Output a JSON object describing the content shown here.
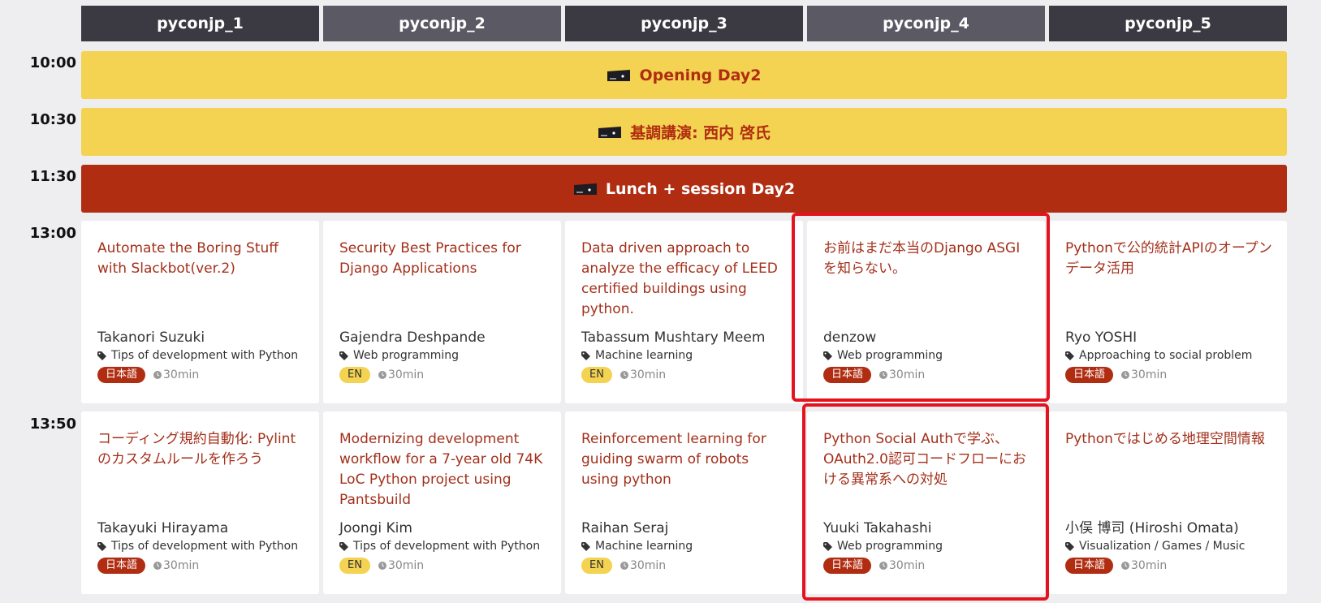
{
  "rooms": [
    "pyconjp_1",
    "pyconjp_2",
    "pyconjp_3",
    "pyconjp_4",
    "pyconjp_5"
  ],
  "times": [
    "10:00",
    "10:30",
    "11:30",
    "13:00",
    "13:50"
  ],
  "plenaries": [
    {
      "title": "Opening Day2",
      "style": "yellow",
      "icon": "ticket-icon"
    },
    {
      "title": "基調講演: 西内 啓氏",
      "style": "yellow",
      "icon": "ticket-icon"
    },
    {
      "title": "Lunch + session Day2",
      "style": "red",
      "icon": "ticket-icon"
    }
  ],
  "rows": [
    {
      "sessions": [
        {
          "title": "Automate the Boring Stuff with Slackbot(ver.2)",
          "speaker": "Takanori Suzuki",
          "category": "Tips of development with Python",
          "language": "日本語",
          "lang_code": "ja",
          "duration": "30min"
        },
        {
          "title": "Security Best Practices for Django Applications",
          "speaker": "Gajendra Deshpande",
          "category": "Web programming",
          "language": "EN",
          "lang_code": "en",
          "duration": "30min"
        },
        {
          "title": "Data driven approach to analyze the efficacy of LEED certified buildings using python.",
          "speaker": "Tabassum Mushtary Meem",
          "category": "Machine learning",
          "language": "EN",
          "lang_code": "en",
          "duration": "30min"
        },
        {
          "title": "お前はまだ本当のDjango ASGIを知らない。",
          "speaker": "denzow",
          "category": "Web programming",
          "language": "日本語",
          "lang_code": "ja",
          "duration": "30min"
        },
        {
          "title": "Pythonで公的統計APIのオープンデータ活用",
          "speaker": "Ryo YOSHI",
          "category": "Approaching to social problem",
          "language": "日本語",
          "lang_code": "ja",
          "duration": "30min"
        }
      ]
    },
    {
      "sessions": [
        {
          "title": "コーディング規約自動化: Pylintのカスタムルールを作ろう",
          "speaker": "Takayuki Hirayama",
          "category": "Tips of development with Python",
          "language": "日本語",
          "lang_code": "ja",
          "duration": "30min"
        },
        {
          "title": "Modernizing development workflow for a 7-year old 74K LoC Python project using Pantsbuild",
          "speaker": "Joongi Kim",
          "category": "Tips of development with Python",
          "language": "EN",
          "lang_code": "en",
          "duration": "30min"
        },
        {
          "title": "Reinforcement learning for guiding swarm of robots using python",
          "speaker": "Raihan Seraj",
          "category": "Machine learning",
          "language": "EN",
          "lang_code": "en",
          "duration": "30min"
        },
        {
          "title": "Python Social Authで学ぶ、OAuth2.0認可コードフローにおける異常系への対処",
          "speaker": "Yuuki Takahashi",
          "category": "Web programming",
          "language": "日本語",
          "lang_code": "ja",
          "duration": "30min"
        },
        {
          "title": "Pythonではじめる地理空間情報",
          "speaker": "小俣 博司 (Hiroshi Omata)",
          "category": "Visualization / Games / Music",
          "language": "日本語",
          "lang_code": "ja",
          "duration": "30min"
        }
      ]
    }
  ],
  "colors": {
    "accent_red": "#b12d12",
    "accent_yellow": "#f3d351",
    "header_dark": "#3b3a42",
    "header_light": "#5b5a64",
    "highlight": "#e3141f"
  }
}
